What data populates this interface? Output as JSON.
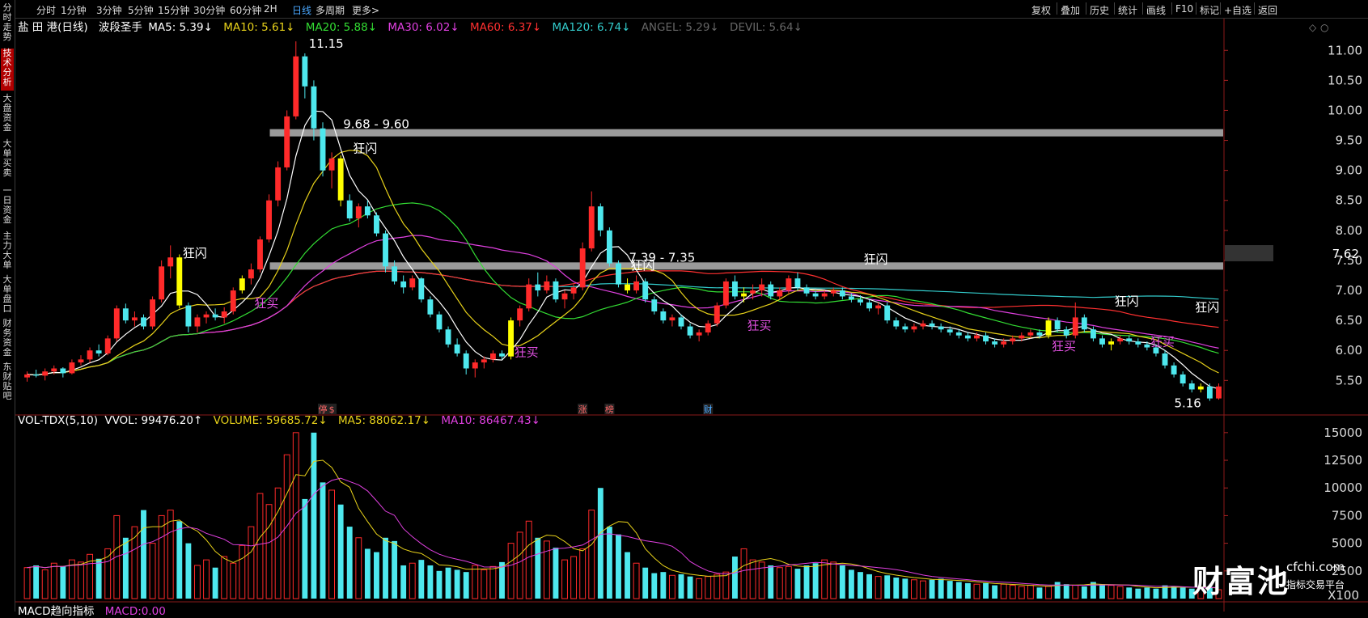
{
  "sidebar": {
    "tabs": [
      "分时走势",
      "技术分析",
      "大盘资金",
      "大单买卖",
      "一日资金",
      "主力大单",
      "大单盘口",
      "财务资金",
      "东财贴吧"
    ],
    "active_index": 1
  },
  "toolbar": {
    "periods": [
      "分时",
      "1分钟",
      "3分钟",
      "5分钟",
      "15分钟",
      "30分钟",
      "60分钟",
      "2H",
      "日线",
      "多周期",
      "更多>"
    ],
    "active_period": "日线",
    "right_tools": [
      "复权",
      "叠加",
      "历史",
      "统计",
      "画线",
      "F10",
      "标记",
      "+自选",
      "返回"
    ]
  },
  "legend_main": {
    "name": "盐 田 港(日线)",
    "indicator": "波段圣手",
    "ma5": "MA5: 5.39↓",
    "ma10": "MA10: 5.61↓",
    "ma20": "MA20: 5.88↓",
    "ma30": "MA30: 6.02↓",
    "ma60": "MA60: 6.37↓",
    "ma120": "MA120: 6.74↓",
    "angel": "ANGEL: 5.29↓",
    "devil": "DEVIL: 5.64↓"
  },
  "legend_vol": {
    "name": "VOL-TDX(5,10)",
    "vvol": "VVOL: 99476.20↑",
    "volume": "VOLUME: 59685.72↓",
    "ma5": "MA5: 88062.17↓",
    "ma10": "MA10: 86467.43↓"
  },
  "legend_macd": {
    "name": "MACD趋向指标",
    "value": "MACD:0.00"
  },
  "colors": {
    "up": "#ff2a2a",
    "down": "#4ee8ee",
    "ma5": "#ffffff",
    "ma10": "#e8d21a",
    "ma20": "#33dd33",
    "ma30": "#e040e0",
    "ma60": "#ff3030",
    "ma120": "#33cccc",
    "signal": "#ffff00",
    "band": "#9a9a9a",
    "grid": "#3a0000",
    "buy_text": "#e050e0",
    "price_tag_bg": "#333333"
  },
  "chart_data": [
    {
      "type": "candlestick",
      "title": "盐 田 港(日线)",
      "ylim": [
        5.1,
        11.3
      ],
      "yticks": [
        5.5,
        6.0,
        6.5,
        7.0,
        7.5,
        8.0,
        8.5,
        9.0,
        9.5,
        10.0,
        10.5,
        11.0
      ],
      "price_tag": "7.62",
      "price_tag_value": 7.62,
      "bands": [
        {
          "value": 9.62,
          "label": "9.68 - 9.60"
        },
        {
          "value": 7.4,
          "label": "7.39 - 7.35"
        }
      ],
      "extreme_labels": [
        {
          "text": "11.15",
          "index": 30,
          "value": 11.15
        },
        {
          "text": "5.16",
          "index": 133,
          "value": 5.16
        }
      ],
      "signals": [
        {
          "text": "狂闪",
          "index": 17,
          "value": 7.55,
          "color": "#ffffff"
        },
        {
          "text": "狂买",
          "index": 25,
          "value": 6.72,
          "color": "#e050e0"
        },
        {
          "text": "狂闪",
          "index": 36,
          "value": 9.3,
          "color": "#ffffff"
        },
        {
          "text": "狂买",
          "index": 54,
          "value": 5.9,
          "color": "#e050e0"
        },
        {
          "text": "狂闪",
          "index": 67,
          "value": 7.35,
          "color": "#ffffff"
        },
        {
          "text": "狂买",
          "index": 80,
          "value": 6.35,
          "color": "#e050e0"
        },
        {
          "text": "狂闪",
          "index": 93,
          "value": 7.45,
          "color": "#ffffff"
        },
        {
          "text": "狂买",
          "index": 114,
          "value": 6.0,
          "color": "#e050e0"
        },
        {
          "text": "狂闪",
          "index": 121,
          "value": 6.75,
          "color": "#ffffff"
        },
        {
          "text": "狂买",
          "index": 125,
          "value": 6.08,
          "color": "#e050e0"
        },
        {
          "text": "狂闪",
          "index": 130,
          "value": 6.65,
          "color": "#ffffff"
        }
      ],
      "signal_candles": [
        17,
        24,
        35,
        54,
        67,
        80,
        114,
        121,
        131
      ],
      "events": [
        {
          "text": "停",
          "index": 33
        },
        {
          "text": "$",
          "index": 34
        },
        {
          "text": "涨",
          "index": 62
        },
        {
          "text": "榜",
          "index": 65
        },
        {
          "text": "财",
          "index": 76
        }
      ],
      "ohlc": [
        [
          5.55,
          5.65,
          5.48,
          5.6
        ],
        [
          5.6,
          5.68,
          5.55,
          5.58
        ],
        [
          5.58,
          5.7,
          5.5,
          5.65
        ],
        [
          5.65,
          5.75,
          5.6,
          5.7
        ],
        [
          5.7,
          5.72,
          5.55,
          5.62
        ],
        [
          5.62,
          5.85,
          5.6,
          5.8
        ],
        [
          5.8,
          5.92,
          5.75,
          5.85
        ],
        [
          5.85,
          6.05,
          5.8,
          6.0
        ],
        [
          6.0,
          6.1,
          5.9,
          5.95
        ],
        [
          5.95,
          6.25,
          5.92,
          6.2
        ],
        [
          6.2,
          6.75,
          6.15,
          6.7
        ],
        [
          6.7,
          6.78,
          6.45,
          6.5
        ],
        [
          6.5,
          6.65,
          6.4,
          6.55
        ],
        [
          6.55,
          6.6,
          6.35,
          6.4
        ],
        [
          6.4,
          6.9,
          6.35,
          6.85
        ],
        [
          6.85,
          7.5,
          6.8,
          7.4
        ],
        [
          7.4,
          7.75,
          7.2,
          7.55
        ],
        [
          7.55,
          7.6,
          6.7,
          6.75
        ],
        [
          6.75,
          6.8,
          6.3,
          6.4
        ],
        [
          6.4,
          6.6,
          6.3,
          6.55
        ],
        [
          6.55,
          6.65,
          6.45,
          6.6
        ],
        [
          6.6,
          6.7,
          6.5,
          6.55
        ],
        [
          6.55,
          6.72,
          6.45,
          6.65
        ],
        [
          6.65,
          7.05,
          6.6,
          7.0
        ],
        [
          7.0,
          7.25,
          6.95,
          7.2
        ],
        [
          7.2,
          7.45,
          7.1,
          7.35
        ],
        [
          7.35,
          7.9,
          7.3,
          7.85
        ],
        [
          7.85,
          8.6,
          7.8,
          8.5
        ],
        [
          8.5,
          9.15,
          8.4,
          9.05
        ],
        [
          9.05,
          10.0,
          9.0,
          9.9
        ],
        [
          9.9,
          11.15,
          9.85,
          10.9
        ],
        [
          10.9,
          10.95,
          10.2,
          10.4
        ],
        [
          10.4,
          10.5,
          9.5,
          9.7
        ],
        [
          9.7,
          9.8,
          8.9,
          9.0
        ],
        [
          9.0,
          9.3,
          8.7,
          9.2
        ],
        [
          9.2,
          9.25,
          8.4,
          8.5
        ],
        [
          8.5,
          8.6,
          8.15,
          8.2
        ],
        [
          8.2,
          8.45,
          8.05,
          8.4
        ],
        [
          8.4,
          8.5,
          8.2,
          8.25
        ],
        [
          8.25,
          8.3,
          7.9,
          7.95
        ],
        [
          7.95,
          8.0,
          7.3,
          7.4
        ],
        [
          7.4,
          7.5,
          7.1,
          7.15
        ],
        [
          7.15,
          7.25,
          6.95,
          7.05
        ],
        [
          7.05,
          7.25,
          7.0,
          7.2
        ],
        [
          7.2,
          7.22,
          6.8,
          6.85
        ],
        [
          6.85,
          6.9,
          6.55,
          6.6
        ],
        [
          6.6,
          6.65,
          6.3,
          6.35
        ],
        [
          6.35,
          6.4,
          6.05,
          6.1
        ],
        [
          6.1,
          6.2,
          5.9,
          5.95
        ],
        [
          5.95,
          6.0,
          5.6,
          5.7
        ],
        [
          5.7,
          5.85,
          5.55,
          5.8
        ],
        [
          5.8,
          5.9,
          5.7,
          5.85
        ],
        [
          5.85,
          6.0,
          5.8,
          5.95
        ],
        [
          5.95,
          6.0,
          5.85,
          5.9
        ],
        [
          5.9,
          6.55,
          5.85,
          6.5
        ],
        [
          6.5,
          6.75,
          6.4,
          6.7
        ],
        [
          6.7,
          7.2,
          6.65,
          7.1
        ],
        [
          7.1,
          7.3,
          6.9,
          7.0
        ],
        [
          7.0,
          7.25,
          6.95,
          7.15
        ],
        [
          7.15,
          7.2,
          6.8,
          6.85
        ],
        [
          6.85,
          7.0,
          6.7,
          6.95
        ],
        [
          6.95,
          7.1,
          6.85,
          7.05
        ],
        [
          7.05,
          7.8,
          7.0,
          7.7
        ],
        [
          7.7,
          8.65,
          7.65,
          8.4
        ],
        [
          8.4,
          8.45,
          7.9,
          8.0
        ],
        [
          8.0,
          8.05,
          7.4,
          7.45
        ],
        [
          7.45,
          7.5,
          7.05,
          7.1
        ],
        [
          7.1,
          7.2,
          6.95,
          7.0
        ],
        [
          7.0,
          7.25,
          6.95,
          7.15
        ],
        [
          7.15,
          7.2,
          6.8,
          6.85
        ],
        [
          6.85,
          6.9,
          6.6,
          6.65
        ],
        [
          6.65,
          6.7,
          6.45,
          6.5
        ],
        [
          6.5,
          6.6,
          6.4,
          6.55
        ],
        [
          6.55,
          6.6,
          6.35,
          6.4
        ],
        [
          6.4,
          6.45,
          6.2,
          6.25
        ],
        [
          6.25,
          6.35,
          6.15,
          6.3
        ],
        [
          6.3,
          6.5,
          6.25,
          6.45
        ],
        [
          6.45,
          6.8,
          6.4,
          6.75
        ],
        [
          6.75,
          7.2,
          6.7,
          7.15
        ],
        [
          7.15,
          7.25,
          6.85,
          6.9
        ],
        [
          6.9,
          7.05,
          6.8,
          6.95
        ],
        [
          6.95,
          7.1,
          6.85,
          7.0
        ],
        [
          7.0,
          7.2,
          6.9,
          7.1
        ],
        [
          7.1,
          7.15,
          6.85,
          6.9
        ],
        [
          6.9,
          7.05,
          6.85,
          7.0
        ],
        [
          7.0,
          7.25,
          6.95,
          7.2
        ],
        [
          7.2,
          7.3,
          7.0,
          7.05
        ],
        [
          7.05,
          7.1,
          6.9,
          6.95
        ],
        [
          6.95,
          7.0,
          6.85,
          6.9
        ],
        [
          6.9,
          7.0,
          6.85,
          6.95
        ],
        [
          6.95,
          7.05,
          6.9,
          7.0
        ],
        [
          7.0,
          7.05,
          6.85,
          6.9
        ],
        [
          6.9,
          6.95,
          6.8,
          6.85
        ],
        [
          6.85,
          6.92,
          6.75,
          6.8
        ],
        [
          6.8,
          6.85,
          6.65,
          6.7
        ],
        [
          6.7,
          6.8,
          6.6,
          6.75
        ],
        [
          6.75,
          6.8,
          6.45,
          6.5
        ],
        [
          6.5,
          6.55,
          6.35,
          6.4
        ],
        [
          6.4,
          6.45,
          6.3,
          6.35
        ],
        [
          6.35,
          6.45,
          6.3,
          6.4
        ],
        [
          6.4,
          6.5,
          6.35,
          6.45
        ],
        [
          6.45,
          6.5,
          6.35,
          6.4
        ],
        [
          6.4,
          6.45,
          6.3,
          6.35
        ],
        [
          6.35,
          6.4,
          6.25,
          6.3
        ],
        [
          6.3,
          6.35,
          6.2,
          6.25
        ],
        [
          6.25,
          6.3,
          6.15,
          6.2
        ],
        [
          6.2,
          6.3,
          6.15,
          6.25
        ],
        [
          6.25,
          6.3,
          6.1,
          6.15
        ],
        [
          6.15,
          6.2,
          6.05,
          6.1
        ],
        [
          6.1,
          6.2,
          6.05,
          6.15
        ],
        [
          6.15,
          6.25,
          6.1,
          6.2
        ],
        [
          6.2,
          6.3,
          6.15,
          6.25
        ],
        [
          6.25,
          6.35,
          6.2,
          6.3
        ],
        [
          6.3,
          6.35,
          6.2,
          6.25
        ],
        [
          6.25,
          6.55,
          6.2,
          6.5
        ],
        [
          6.5,
          6.55,
          6.3,
          6.35
        ],
        [
          6.35,
          6.4,
          6.2,
          6.25
        ],
        [
          6.25,
          6.8,
          6.2,
          6.55
        ],
        [
          6.55,
          6.6,
          6.3,
          6.35
        ],
        [
          6.35,
          6.4,
          6.15,
          6.2
        ],
        [
          6.2,
          6.25,
          6.05,
          6.1
        ],
        [
          6.1,
          6.2,
          6.0,
          6.15
        ],
        [
          6.15,
          6.25,
          6.1,
          6.2
        ],
        [
          6.2,
          6.25,
          6.1,
          6.15
        ],
        [
          6.15,
          6.2,
          6.05,
          6.1
        ],
        [
          6.1,
          6.15,
          6.0,
          6.05
        ],
        [
          6.05,
          6.1,
          5.9,
          5.95
        ],
        [
          5.95,
          6.0,
          5.7,
          5.75
        ],
        [
          5.75,
          5.8,
          5.55,
          5.6
        ],
        [
          5.6,
          5.65,
          5.4,
          5.45
        ],
        [
          5.45,
          5.5,
          5.3,
          5.35
        ],
        [
          5.35,
          5.45,
          5.3,
          5.4
        ],
        [
          5.4,
          5.45,
          5.16,
          5.2
        ],
        [
          5.2,
          5.45,
          5.18,
          5.4
        ]
      ],
      "ma": {
        "ma5": "#ffffff",
        "ma10": "#e8d21a",
        "ma20": "#33dd33",
        "ma30": "#e040e0",
        "ma60": "#ff3030",
        "ma120": "#33cccc"
      }
    },
    {
      "type": "bar",
      "title": "VOL-TDX(5,10)",
      "ylim": [
        0,
        15500
      ],
      "yticks": [
        2500,
        5000,
        7500,
        10000,
        12500,
        15000
      ],
      "unit_label": "X100",
      "series": [
        {
          "name": "VOLUME",
          "values": [
            2800,
            3000,
            2600,
            3200,
            2900,
            3500,
            3300,
            4000,
            3600,
            4500,
            7500,
            5500,
            6500,
            8000,
            5000,
            7500,
            8000,
            7000,
            5000,
            3000,
            3500,
            2800,
            3800,
            3200,
            4800,
            6500,
            9500,
            8500,
            10000,
            13000,
            15000,
            9000,
            15000,
            10500,
            9800,
            8500,
            6500,
            5500,
            4500,
            4200,
            5500,
            5200,
            3000,
            3200,
            3500,
            3000,
            2500,
            2800,
            2600,
            2400,
            3000,
            2600,
            2900,
            3300,
            5000,
            6000,
            7000,
            5500,
            5200,
            4600,
            3500,
            3800,
            4500,
            8000,
            10000,
            6500,
            5800,
            4200,
            3200,
            2800,
            2300,
            2400,
            2100,
            2200,
            2000,
            1800,
            2000,
            2200,
            2400,
            3800,
            4500,
            3500,
            3300,
            3000,
            2800,
            2900,
            2700,
            3000,
            3200,
            3500,
            3300,
            3000,
            2600,
            2400,
            2200,
            2000,
            2100,
            1900,
            1800,
            1700,
            1600,
            1700,
            1800,
            1600,
            1500,
            1400,
            1300,
            1400,
            1200,
            1300,
            1200,
            1100,
            1200,
            1000,
            1100,
            1500,
            1300,
            1200,
            1100,
            1500,
            1300,
            1200,
            1100,
            1000,
            900,
            1000,
            900,
            1200,
            1100,
            1000,
            900,
            1000,
            1050,
            800
          ]
        }
      ],
      "candle_dir_from": "ohlc"
    }
  ],
  "watermark": {
    "name": "财富池",
    "url": "cfchi.com",
    "sub": "指标交易平台"
  }
}
